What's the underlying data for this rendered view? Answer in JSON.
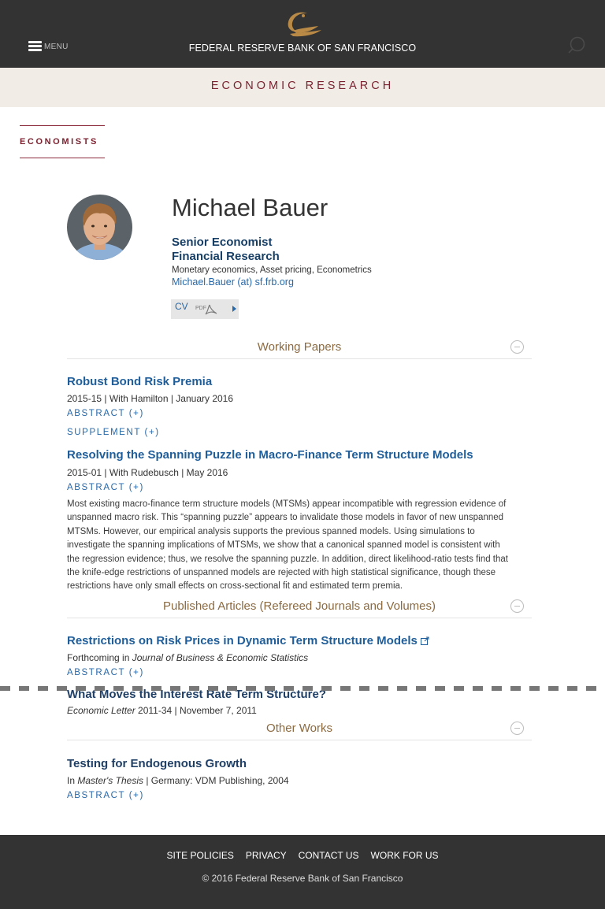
{
  "header": {
    "menu_label": "MENU",
    "bank_name": "FEDERAL RESERVE BANK OF SAN FRANCISCO",
    "section_title": "ECONOMIC RESEARCH",
    "brand_color": "#b98a45"
  },
  "left_nav": {
    "label": "ECONOMISTS"
  },
  "profile": {
    "name": "Michael Bauer",
    "title": "Senior Economist",
    "department": "Financial Research",
    "interests": "Monetary economics, Asset pricing, Econometrics",
    "email": "Michael.Bauer (at) sf.frb.org",
    "cv_label": "CV",
    "cv_icon": "pdf-icon"
  },
  "working_papers": {
    "heading": "Working Papers",
    "items": [
      {
        "title": "Robust Bond Risk Premia",
        "meta": "2015-15 | With Hamilton | January 2016",
        "abstract_toggle": "ABSTRACT (+)",
        "supplement_toggle": "SUPPLEMENT (+)"
      },
      {
        "title": "Resolving the Spanning Puzzle in Macro-Finance Term Structure Models",
        "meta": "2015-01 | With Rudebusch | May 2016",
        "abstract_toggle": "ABSTRACT (+)",
        "abstract_lines": [
          "Most existing macro-finance term structure models (MTSMs) appear incompatible with regression evidence of",
          "unspanned macro risk. This “spanning puzzle” appears to invalidate those models in favor of new unspanned",
          "MTSMs. However, our empirical analysis supports the previous spanned models. Using simulations to",
          "investigate the spanning implications of MTSMs, we show that a canonical spanned model is consistent with",
          "the regression evidence; thus, we resolve the spanning puzzle. In addition, direct likelihood-ratio tests find that",
          "the knife-edge restrictions of unspanned models are rejected with high statistical significance, though these",
          "restrictions have only small effects on cross-sectional fit and estimated term premia."
        ]
      }
    ]
  },
  "published": {
    "heading": "Published Articles (Refereed Journals and Volumes)",
    "items": [
      {
        "title": "Restrictions on Risk Prices in Dynamic Term Structure Models",
        "meta_prefix": "Forthcoming in ",
        "meta_italic": "Journal of Business & Economic Statistics",
        "abstract_toggle": "ABSTRACT (+)",
        "link_icon": "external-link-icon"
      },
      {
        "title": "What Moves the Interest Rate Term Structure?",
        "meta_italic": "Economic Letter",
        "meta_suffix": " 2011-34 | November 7, 2011"
      }
    ]
  },
  "other_works": {
    "heading": "Other Works",
    "items": [
      {
        "title": "Testing for Endogenous Growth",
        "meta_prefix": "In ",
        "meta_italic": "Master's Thesis",
        "meta_suffix": " | Germany: VDM Publishing, 2004",
        "abstract_toggle": "ABSTRACT (+)"
      }
    ]
  },
  "footer": {
    "links": [
      "SITE POLICIES",
      "PRIVACY",
      "CONTACT US",
      "WORK FOR US"
    ],
    "copyright": "© 2016 Federal Reserve Bank of San Francisco"
  }
}
